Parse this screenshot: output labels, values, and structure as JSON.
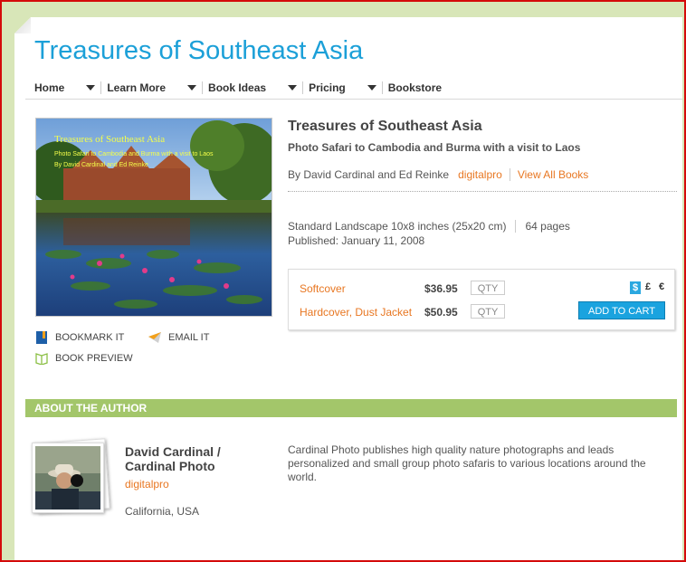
{
  "site": {
    "title": "Treasures of Southeast Asia"
  },
  "nav": [
    {
      "label": "Home"
    },
    {
      "label": "Learn More"
    },
    {
      "label": "Book Ideas"
    },
    {
      "label": "Pricing"
    },
    {
      "label": "Bookstore"
    }
  ],
  "cover": {
    "title": "Treasures of Southeast Asia",
    "subtitle": "Photo Safari to Cambodia and Burma with a visit to Laos",
    "authors": "By David Cardinal and Ed Reinke"
  },
  "actions": {
    "bookmark": "BOOKMARK IT",
    "email": "EMAIL IT",
    "preview": "BOOK PREVIEW"
  },
  "book": {
    "title": "Treasures of Southeast Asia",
    "subtitle": "Photo Safari to Cambodia and Burma with a visit to Laos",
    "byline": "By David Cardinal and Ed Reinke",
    "publisher_link": "digitalpro",
    "view_all": "View All Books",
    "format": "Standard Landscape 10x8 inches (25x20 cm)",
    "pages": "64 pages",
    "published": "Published: January 11, 2008"
  },
  "purchase": {
    "options": [
      {
        "label": "Softcover",
        "price": "$36.95",
        "qty_placeholder": "QTY"
      },
      {
        "label": "Hardcover, Dust Jacket",
        "price": "$50.95",
        "qty_placeholder": "QTY"
      }
    ],
    "currencies": [
      "$",
      "£",
      "€"
    ],
    "selected_currency": "$",
    "add_to_cart": "ADD TO CART"
  },
  "about": {
    "heading": "ABOUT THE AUTHOR",
    "name_line1": "David Cardinal /",
    "name_line2": "Cardinal Photo",
    "link": "digitalpro",
    "location": "California, USA",
    "bio": "Cardinal Photo publishes high quality nature photographs and leads personalized and small group photo safaris to various locations around the world."
  },
  "colors": {
    "brand_blue": "#1ca0d8",
    "link_orange": "#e87722",
    "section_green": "#a3c66a",
    "cart_blue": "#1aa3df"
  }
}
